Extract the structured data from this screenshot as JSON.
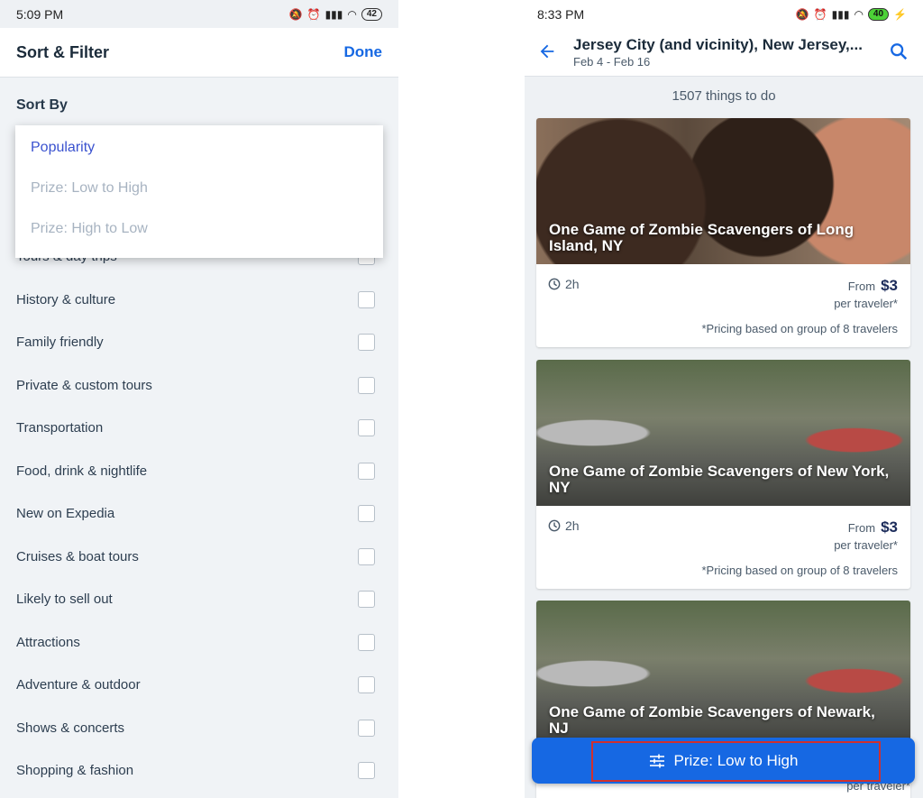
{
  "left": {
    "status": {
      "time": "5:09 PM",
      "battery": "42"
    },
    "header": {
      "title": "Sort & Filter",
      "done": "Done"
    },
    "sort_label": "Sort By",
    "sort_options": [
      {
        "label": "Popularity",
        "selected": true
      },
      {
        "label": "Prize: Low to High",
        "selected": false
      },
      {
        "label": "Prize: High to Low",
        "selected": false
      }
    ],
    "filters": [
      "Tours & day trips",
      "History & culture",
      "Family friendly",
      "Private & custom tours",
      "Transportation",
      "Food, drink & nightlife",
      "New on Expedia",
      "Cruises & boat tours",
      "Likely to sell out",
      "Attractions",
      "Adventure & outdoor",
      "Shows & concerts",
      "Shopping & fashion"
    ]
  },
  "right": {
    "status": {
      "time": "8:33 PM",
      "battery": "40"
    },
    "header": {
      "title": "Jersey City (and vicinity), New Jersey,...",
      "dates": "Feb 4 - Feb 16"
    },
    "count": "1507 things to do",
    "cards": [
      {
        "title": "One Game of Zombie Scavengers of Long Island, NY",
        "duration": "2h",
        "from": "From",
        "price": "$3",
        "per": "per traveler*",
        "note": "*Pricing based on group of 8 travelers"
      },
      {
        "title": "One Game of Zombie Scavengers of New York, NY",
        "duration": "2h",
        "from": "From",
        "price": "$3",
        "per": "per traveler*",
        "note": "*Pricing based on group of 8 travelers"
      },
      {
        "title": "One Game of Zombie Scavengers of Newark, NJ"
      }
    ],
    "fab": {
      "label": "Prize: Low to High"
    },
    "peek": "per traveler*"
  },
  "colors": {
    "accent": "#1668e3",
    "selected_option": "#3a52cf",
    "highlight_outline": "#d0302e"
  }
}
